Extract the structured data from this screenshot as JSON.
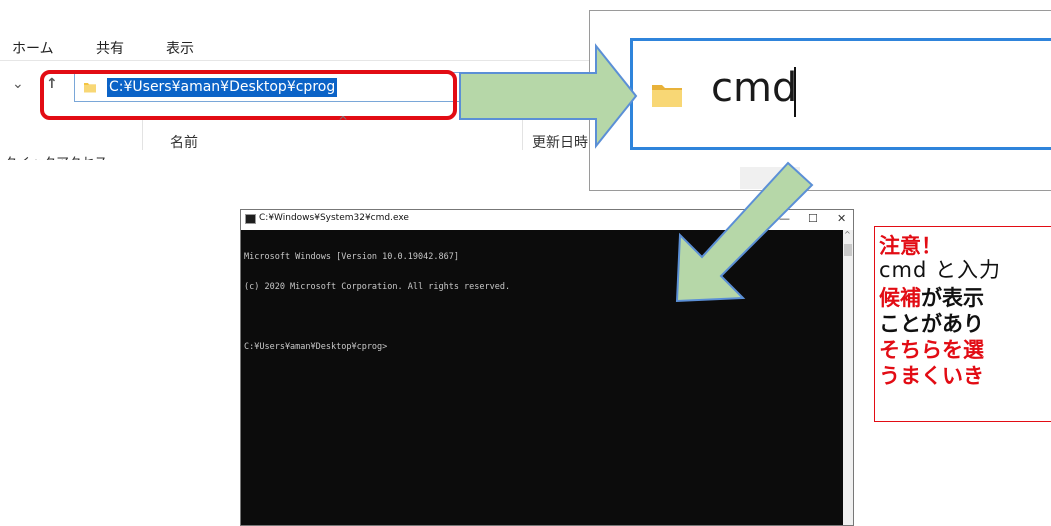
{
  "explorer": {
    "ribbon_tabs": [
      "ホーム",
      "共有",
      "表示"
    ],
    "address_path": "C:¥Users¥aman¥Desktop¥cprog",
    "column_name": "名前",
    "column_date": "更新日時",
    "nav_partial": "クイックアクセス"
  },
  "zoom": {
    "typed_text": "cmd"
  },
  "cmd": {
    "title": "C:¥Windows¥System32¥cmd.exe",
    "lines": [
      "Microsoft Windows [Version 10.0.19042.867]",
      "(c) 2020 Microsoft Corporation. All rights reserved.",
      "",
      "C:¥Users¥aman¥Desktop¥cprog>"
    ]
  },
  "note": {
    "title": "注意！",
    "line1": "cmd と入力",
    "line2_red": "候補",
    "line2_rest": "が表示",
    "line3": "ことがあり",
    "line4": "そちらを選",
    "line5": "うまくいき"
  },
  "colors": {
    "highlight_red": "#e20c14",
    "arrow_green": "#b6d7a8",
    "arrow_outline": "#5b8fd6",
    "selection_blue": "#0b63c7"
  }
}
